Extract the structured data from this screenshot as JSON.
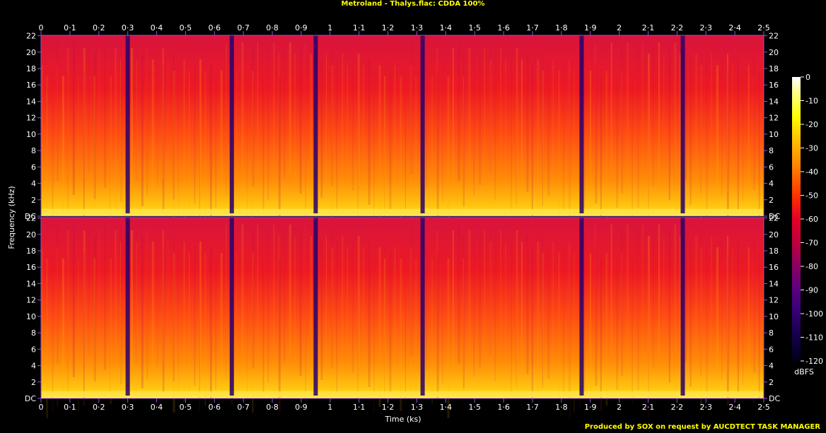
{
  "title": "Metroland - Thalys.flac: CDDA 100%",
  "footer": "Produced by SOX on request by AUCDTECT TASK MANAGER",
  "chart_data": {
    "type": "heatmap",
    "xlabel": "Time (ks)",
    "ylabel": "Frequency (kHz)",
    "colorbar_label": "dBFS",
    "xlim": [
      0,
      2.5
    ],
    "ylim": [
      0,
      22.05
    ],
    "x_ticks": [
      "0",
      "0·1",
      "0·2",
      "0·3",
      "0·4",
      "0·5",
      "0·6",
      "0·7",
      "0·8",
      "0·9",
      "1",
      "1·1",
      "1·2",
      "1·3",
      "1·4",
      "1·5",
      "1·6",
      "1·7",
      "1·8",
      "1·9",
      "2",
      "2·1",
      "2·2",
      "2·3",
      "2·4",
      "2·5"
    ],
    "y_ticks": [
      "DC",
      "2",
      "4",
      "6",
      "8",
      "10",
      "12",
      "14",
      "16",
      "18",
      "20",
      "22"
    ],
    "colorbar_ticks": [
      "0",
      "-10",
      "-20",
      "-30",
      "-40",
      "-50",
      "-60",
      "-70",
      "-80",
      "-90",
      "-100",
      "-110",
      "-120"
    ],
    "colorbar_range": [
      -120,
      0
    ],
    "channels": 2,
    "colors": {
      "scale": [
        "#ffffff",
        "#ffff80",
        "#ffff00",
        "#ffc000",
        "#ff8000",
        "#ff3000",
        "#e60026",
        "#c0003c",
        "#900060",
        "#600080",
        "#3a007a",
        "#180050",
        "#00001a"
      ],
      "axis": "#a04fc9"
    },
    "dark_gaps_ks": [
      0.3,
      0.66,
      0.95,
      1.32,
      1.87,
      2.22
    ]
  }
}
